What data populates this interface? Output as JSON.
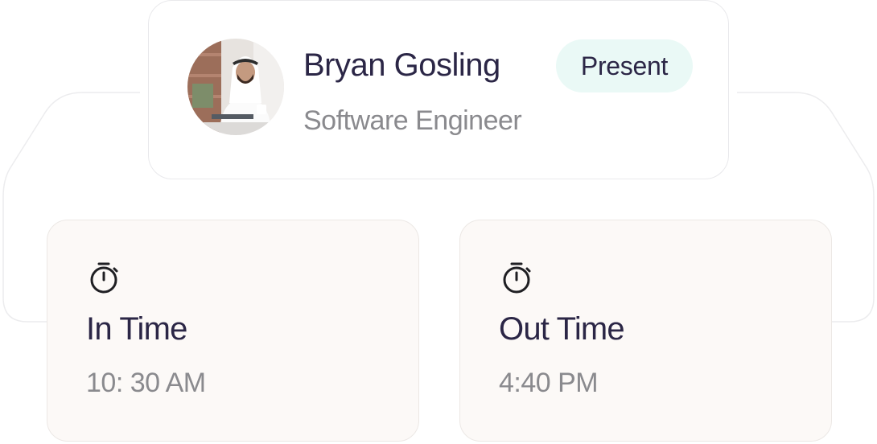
{
  "employee": {
    "name": "Bryan Gosling",
    "role": "Software Engineer",
    "status": "Present",
    "status_color": "#eaf9f6",
    "avatar_icon": "person-avatar"
  },
  "in_time": {
    "label": "In Time",
    "value": "10: 30 AM",
    "icon": "stopwatch-icon"
  },
  "out_time": {
    "label": "Out Time",
    "value": "4:40 PM",
    "icon": "stopwatch-icon"
  },
  "colors": {
    "heading": "#2b2646",
    "muted": "#8a8a8e",
    "time_card_bg": "#fcf9f7"
  }
}
